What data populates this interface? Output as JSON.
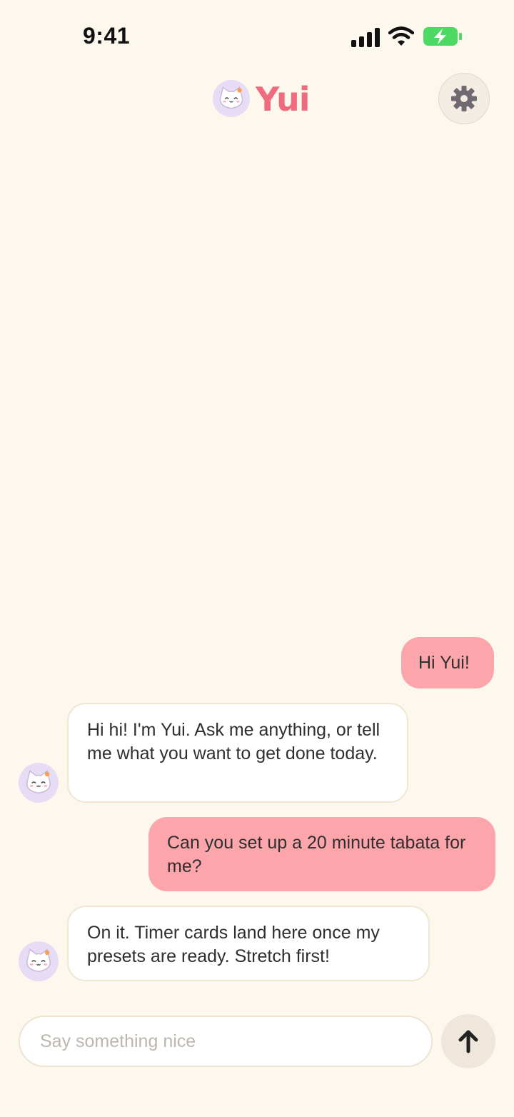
{
  "status": {
    "time": "9:41"
  },
  "header": {
    "app_name": "Yui",
    "avatar_icon": "cat-face-icon",
    "settings_icon": "gear-icon"
  },
  "messages": [
    {
      "role": "user",
      "text": "Hi Yui!"
    },
    {
      "role": "bot",
      "text": "Hi hi! I'm Yui. Ask me anything, or tell me what you want to get done today."
    },
    {
      "role": "user",
      "text": "Can you set up a 20 minute tabata for me?"
    },
    {
      "role": "bot",
      "text": "On it. Timer cards land here once my presets are ready. Stretch first!"
    }
  ],
  "composer": {
    "placeholder": "Say something nice",
    "value": "",
    "send_icon": "arrow-up-icon"
  },
  "colors": {
    "background": "#fdf8ee",
    "accent": "#f06b7d",
    "user_bubble": "#fca6ac",
    "avatar_bg": "#e6dcf6"
  }
}
